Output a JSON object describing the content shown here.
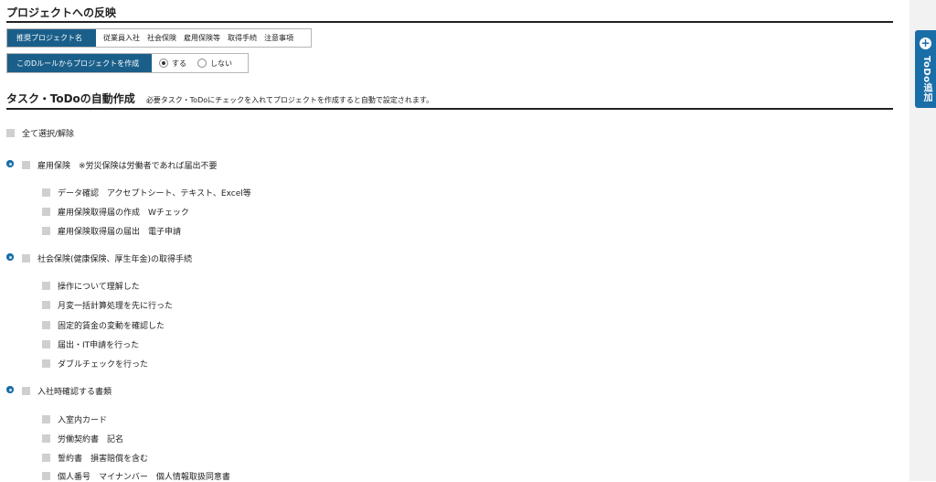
{
  "reflect": {
    "title": "プロジェクトへの反映",
    "recommended": {
      "label": "推奨プロジェクト名",
      "value": "従業員入社　社会保険　雇用保険等　取得手続　注意事項"
    },
    "create": {
      "label": "このDルールからプロジェクトを作成",
      "options": [
        {
          "label": "する",
          "selected": true
        },
        {
          "label": "しない",
          "selected": false
        }
      ]
    }
  },
  "auto": {
    "title": "タスク・ToDoの自動作成",
    "note": "必要タスク・ToDoにチェックを入れてプロジェクトを作成すると自動で設定されます。",
    "select_all": "全て選択/解除",
    "groups": [
      {
        "label": "雇用保険　※労災保険は労働者であれば届出不要",
        "items": [
          "データ確認　アクセプトシート、テキスト、Excel等",
          "雇用保険取得届の作成　Wチェック",
          "雇用保険取得届の届出　電子申請"
        ]
      },
      {
        "label": "社会保険(健康保険、厚生年金)の取得手続",
        "items": [
          "操作について理解した",
          "月変一括計算処理を先に行った",
          "固定的賃金の変動を確認した",
          "届出・IT申請を行った",
          "ダブルチェックを行った"
        ]
      },
      {
        "label": "入社時確認する書類",
        "items": [
          "入室内カード",
          "労働契約書　記名",
          "誓約書　損害賠償を含む",
          "個人番号　マイナンバー　個人情報取扱同意書"
        ]
      }
    ]
  },
  "todo_tab": {
    "label": "ToDo追加"
  },
  "colors": {
    "accent": "#1a6ea8",
    "label_bg": "#1a5f8a",
    "checkbox": "#cfcfcf"
  }
}
